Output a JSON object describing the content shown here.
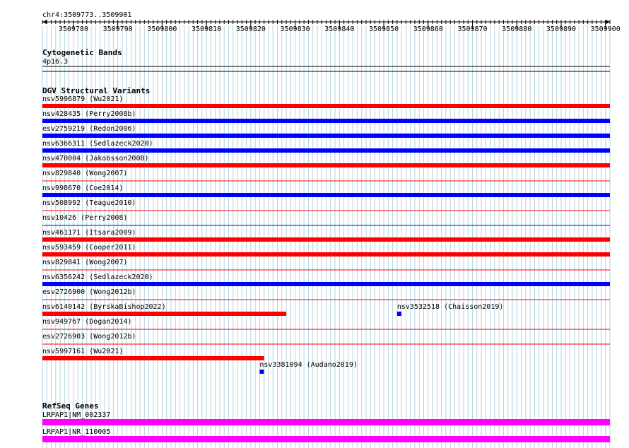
{
  "ruler": {
    "region": "chr4:3509773..3509901",
    "start": 3509773,
    "end": 3509901,
    "tick_labels": [
      "3509780",
      "3509790",
      "3509800",
      "3509810",
      "3509820",
      "3509830",
      "3509840",
      "3509850",
      "3509860",
      "3509870",
      "3509880",
      "3509890",
      "3509900"
    ]
  },
  "colors": {
    "loss": "#ff0000",
    "gain": "#0000ff",
    "gene": "#ff00ff",
    "gridline": "#b4d3e0"
  },
  "cytobands": {
    "title": "Cytogenetic Bands",
    "band": "4p16.3"
  },
  "dgv": {
    "title": "DGV Structural Variants",
    "variants": [
      {
        "label": "nsv5996879 (Wu2021)",
        "color": "red",
        "start": 3509773,
        "end": 3509901
      },
      {
        "label": "nsv428435 (Perry2008b)",
        "color": "blue",
        "start": 3509773,
        "end": 3509901
      },
      {
        "label": "esv2759219 (Redon2006)",
        "color": "blue",
        "start": 3509773,
        "end": 3509901
      },
      {
        "label": "nsv6366311 (Sedlazeck2020)",
        "color": "blue",
        "start": 3509773,
        "end": 3509901
      },
      {
        "label": "nsv470004 (Jakobsson2008)",
        "color": "red",
        "start": 3509773,
        "end": 3509901
      },
      {
        "label": "nsv829840 (Wong2007)",
        "color": "red",
        "start": 3509773,
        "end": 3509901
      },
      {
        "label": "nsv998670 (Coe2014)",
        "color": "blue",
        "start": 3509773,
        "end": 3509901
      },
      {
        "label": "nsv508992 (Teague2010)",
        "color": "red",
        "start": 3509773,
        "end": 3509901
      },
      {
        "label": "nsv10426 (Perry2008)",
        "color": "blue",
        "start": 3509773,
        "end": 3509901
      },
      {
        "label": "nsv461171 (Itsara2009)",
        "color": "red",
        "start": 3509773,
        "end": 3509901
      },
      {
        "label": "nsv593459 (Cooper2011)",
        "color": "red",
        "start": 3509773,
        "end": 3509901
      },
      {
        "label": "nsv829841 (Wong2007)",
        "color": "red",
        "start": 3509773,
        "end": 3509901
      },
      {
        "label": "nsv6356242 (Sedlazeck2020)",
        "color": "blue",
        "start": 3509773,
        "end": 3509901
      },
      {
        "label": "esv2726900 (Wong2012b)",
        "color": "red",
        "start": 3509773,
        "end": 3509901
      },
      {
        "label": "nsv6140142 (ByrskaBishop2022)",
        "color": "red",
        "start": 3509773,
        "end": 3509828
      },
      {
        "label": "nsv3532518 (Chaisson2019)",
        "color": "blue",
        "start": 3509853,
        "end": 3509854
      },
      {
        "label": "nsv949767 (Dogan2014)",
        "color": "red",
        "start": 3509773,
        "end": 3509901
      },
      {
        "label": "esv2726903 (Wong2012b)",
        "color": "red",
        "start": 3509773,
        "end": 3509901
      },
      {
        "label": "nsv5997161 (Wu2021)",
        "color": "red",
        "start": 3509773,
        "end": 3509823
      },
      {
        "label": "nsv3381094 (Audano2019)",
        "color": "blue",
        "start": 3509822,
        "end": 3509823
      }
    ]
  },
  "refseq": {
    "title": "RefSeq Genes",
    "genes": [
      {
        "label": "LRPAP1|NM_002337",
        "start": 3509773,
        "end": 3509901
      },
      {
        "label": "LRPAP1|NR_110005",
        "start": 3509773,
        "end": 3509901
      }
    ]
  }
}
